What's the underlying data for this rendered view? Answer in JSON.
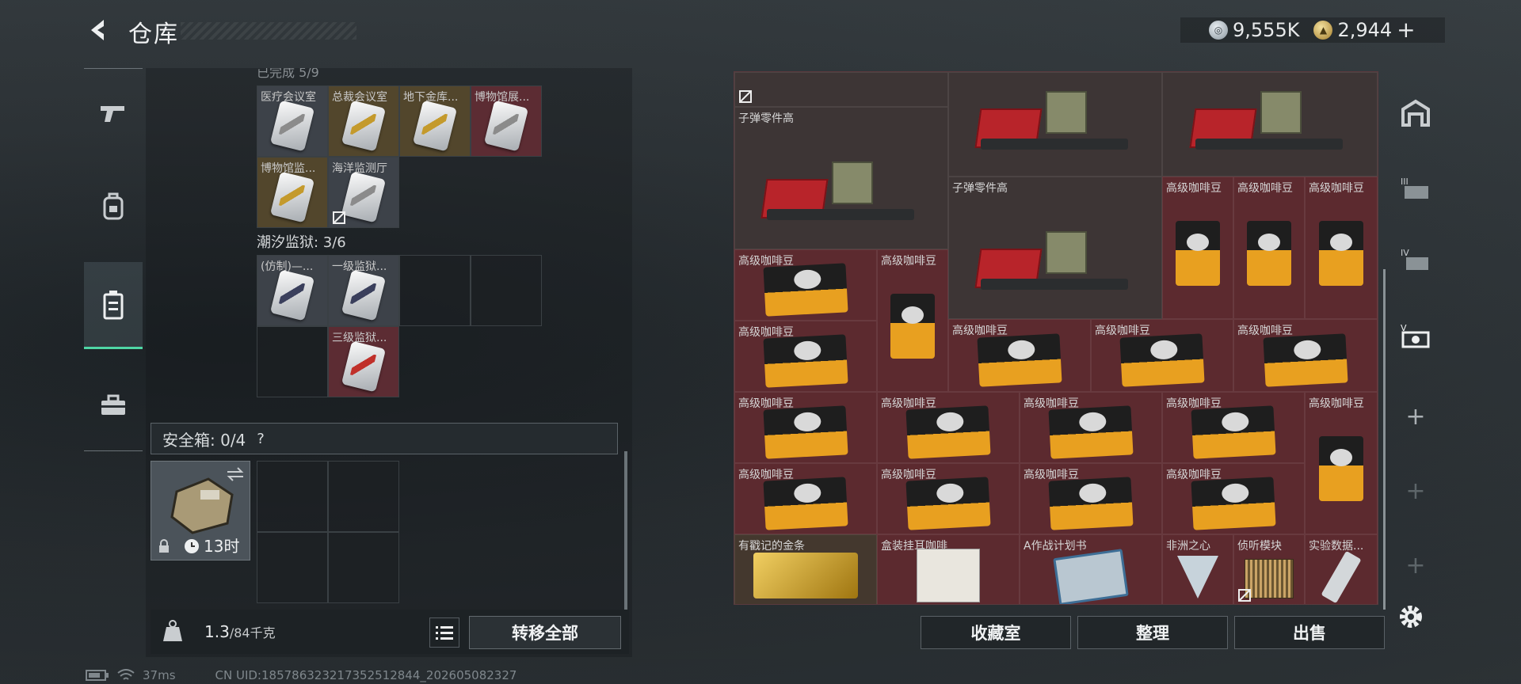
{
  "header": {
    "title": "仓库"
  },
  "currency": {
    "silver": "9,555K",
    "gold": "2,944",
    "add": "+"
  },
  "left_panel": {
    "partial_heading": "已完成 5/9",
    "sections": [
      {
        "title": "潮汐监狱: 3/6"
      }
    ],
    "row1": [
      {
        "label": "医疗会议室",
        "color": "grey"
      },
      {
        "label": "总裁会议室",
        "color": "gold"
      },
      {
        "label": "地下金库...",
        "color": "gold"
      },
      {
        "label": "博物馆展...",
        "color": "red"
      }
    ],
    "row2": [
      {
        "label": "博物馆监...",
        "color": "gold"
      },
      {
        "label": "海洋监测厅",
        "color": "grey"
      }
    ],
    "prison": [
      {
        "label": "(仿制)—...",
        "color": "grey"
      },
      {
        "label": "一级监狱...",
        "color": "grey"
      },
      {
        "label": "三级监狱...",
        "color": "red"
      }
    ],
    "safe": {
      "label": "安全箱: 0/4",
      "help": "?",
      "timer": "13时"
    },
    "weight": {
      "current": "1.3",
      "max": "/84千克"
    },
    "transfer_all": "转移全部"
  },
  "right_panel": {
    "items": {
      "ammo": "子弹零件高",
      "coffee": "高级咖啡豆",
      "goldbar": "有戳记的金条",
      "boxed": "盒装挂耳咖啡",
      "plan": "A作战计划书",
      "africa": "非洲之心",
      "module": "侦听模块",
      "data": "实验数据..."
    },
    "buttons": {
      "collection": "收藏室",
      "sort": "整理",
      "sell": "出售"
    }
  },
  "status": {
    "ping": "37ms",
    "uid": "CN UID:185786323217352512844_202605082327"
  },
  "colors": {
    "accent": "#4fd6a5",
    "red_slot": "#5c2a2f",
    "gold_slot": "#52462c"
  }
}
